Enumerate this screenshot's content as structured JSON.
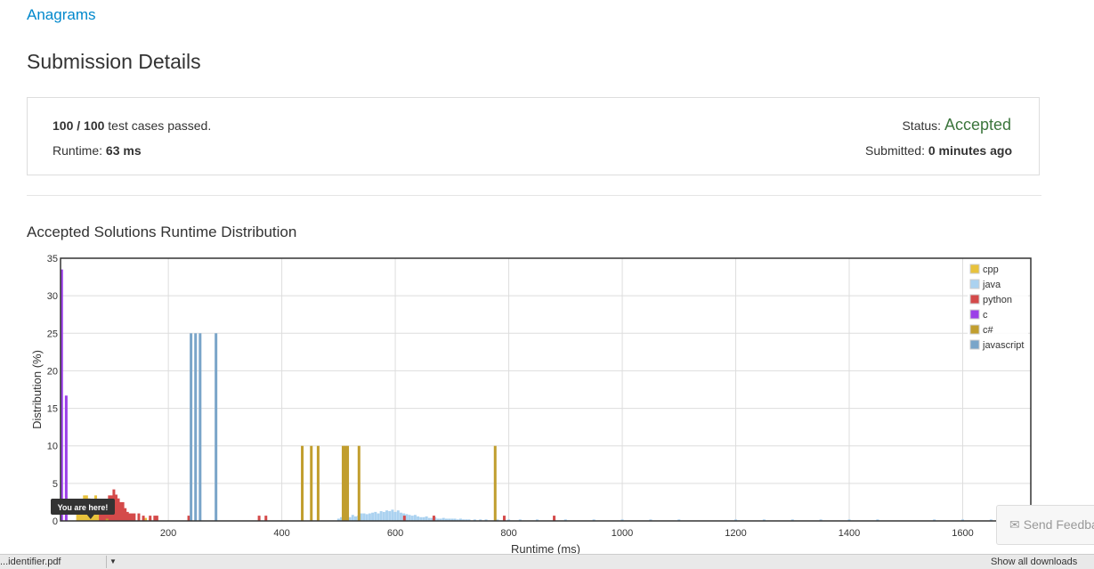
{
  "problem": {
    "title": "Anagrams"
  },
  "page": {
    "heading": "Submission Details"
  },
  "details": {
    "passed_count": "100 / 100",
    "passed_text": " test cases passed.",
    "runtime_label": "Runtime: ",
    "runtime_value": "63 ms",
    "status_label": "Status: ",
    "status_value": "Accepted",
    "submitted_label": "Submitted: ",
    "submitted_value": "0 minutes ago"
  },
  "distribution": {
    "title": "Accepted Solutions Runtime Distribution"
  },
  "feedback": {
    "label": "Send Feedback"
  },
  "bottom_bar": {
    "file_text": "...identifier.pdf",
    "right_text": "Show all downloads"
  },
  "chart_data": {
    "type": "bar",
    "title": "",
    "xlabel": "Runtime (ms)",
    "ylabel": "Distribution (%)",
    "xlim": [
      10,
      1720
    ],
    "ylim": [
      0,
      35
    ],
    "xticks": [
      200,
      400,
      600,
      800,
      1000,
      1200,
      1400,
      1600
    ],
    "yticks": [
      0,
      5,
      10,
      15,
      20,
      25,
      30,
      35
    ],
    "grid": true,
    "legend_position": "top-right",
    "marker_label": "You are here!",
    "marker_x": 63,
    "series": [
      {
        "name": "cpp",
        "color": "#e8c23c",
        "x": [
          40,
          44,
          48,
          52,
          56,
          60,
          64,
          68,
          72,
          76,
          80,
          84,
          88,
          92,
          100,
          108,
          160,
          168
        ],
        "values": [
          1.0,
          1.5,
          2.5,
          3.4,
          3.4,
          3.0,
          2.5,
          1.8,
          3.4,
          2.8,
          1.4,
          1.0,
          0.7,
          0.6,
          0.5,
          0.3,
          0.4,
          0.3
        ]
      },
      {
        "name": "java",
        "color": "#abd2f0",
        "x": [
          500,
          505,
          510,
          515,
          520,
          525,
          530,
          535,
          540,
          545,
          550,
          555,
          560,
          565,
          570,
          575,
          580,
          585,
          590,
          595,
          600,
          605,
          610,
          615,
          620,
          625,
          630,
          635,
          640,
          645,
          650,
          655,
          660,
          665,
          670,
          675,
          680,
          685,
          690,
          695,
          700,
          705,
          710,
          715,
          720,
          725,
          730,
          740,
          750,
          760,
          780,
          800,
          820,
          850,
          880,
          900,
          950,
          1000,
          1050,
          1100,
          1200,
          1250,
          1300,
          1350,
          1400,
          1450,
          1550,
          1600,
          1650
        ],
        "values": [
          0.3,
          0.5,
          0.5,
          0.6,
          0.5,
          0.8,
          0.6,
          0.7,
          1.0,
          1.0,
          0.9,
          1.0,
          1.1,
          1.2,
          1.0,
          1.3,
          1.2,
          1.4,
          1.3,
          1.5,
          1.2,
          1.4,
          1.1,
          1.0,
          0.9,
          0.8,
          0.7,
          0.8,
          0.6,
          0.5,
          0.5,
          0.6,
          0.4,
          0.4,
          0.5,
          0.3,
          0.3,
          0.4,
          0.3,
          0.3,
          0.3,
          0.3,
          0.2,
          0.3,
          0.2,
          0.2,
          0.2,
          0.2,
          0.2,
          0.2,
          0.2,
          0.2,
          0.2,
          0.2,
          0.2,
          0.2,
          0.2,
          0.2,
          0.2,
          0.2,
          0.2,
          0.2,
          0.2,
          0.2,
          0.2,
          0.2,
          0.2,
          0.2,
          0.2
        ]
      },
      {
        "name": "python",
        "color": "#d44a4a",
        "x": [
          80,
          84,
          88,
          92,
          96,
          100,
          104,
          108,
          112,
          116,
          120,
          124,
          128,
          132,
          136,
          140,
          148,
          156,
          168,
          176,
          180,
          236,
          360,
          372,
          616,
          668,
          792,
          880
        ],
        "values": [
          1.6,
          2.0,
          2.0,
          2.5,
          3.4,
          3.4,
          4.2,
          3.5,
          3.0,
          2.5,
          2.5,
          1.7,
          1.2,
          1.0,
          1.0,
          1.0,
          1.0,
          0.7,
          0.7,
          0.7,
          0.7,
          0.7,
          0.7,
          0.7,
          0.7,
          0.7,
          0.7,
          0.7
        ]
      },
      {
        "name": "c",
        "color": "#9b3fe8",
        "x": [
          12,
          20
        ],
        "values": [
          33.5,
          16.7
        ]
      },
      {
        "name": "c#",
        "color": "#c19e2e",
        "x": [
          92,
          436,
          452,
          464,
          508,
          512,
          516,
          536,
          776
        ],
        "values": [
          0.3,
          10,
          10,
          10,
          10,
          10,
          10,
          10,
          10
        ]
      },
      {
        "name": "javascript",
        "color": "#7aa5c9",
        "x": [
          240,
          248,
          256,
          284
        ],
        "values": [
          25,
          25,
          25,
          25
        ]
      }
    ]
  }
}
